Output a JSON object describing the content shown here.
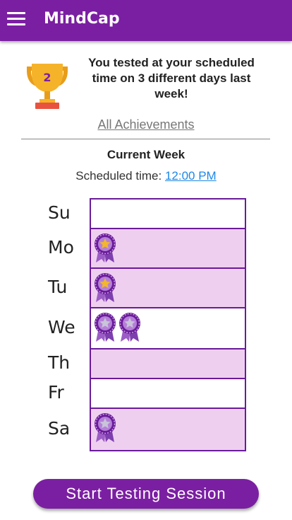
{
  "appbar": {
    "title": "MindCap"
  },
  "achievement": {
    "trophy_number": "2",
    "message": "You tested at your scheduled time on 3 different days last week!",
    "all_achievements_link": "All Achievements"
  },
  "week": {
    "title": "Current Week",
    "scheduled_label": "Scheduled time: ",
    "scheduled_time": "12:00 PM",
    "days": [
      {
        "label": "Su",
        "filled": false,
        "ribbons": []
      },
      {
        "label": "Mo",
        "filled": true,
        "ribbons": [
          "gold"
        ]
      },
      {
        "label": "Tu",
        "filled": true,
        "ribbons": [
          "gold"
        ]
      },
      {
        "label": "We",
        "filled": false,
        "ribbons": [
          "silver",
          "silver"
        ]
      },
      {
        "label": "Th",
        "filled": true,
        "ribbons": []
      },
      {
        "label": "Fr",
        "filled": false,
        "ribbons": []
      },
      {
        "label": "Sa",
        "filled": true,
        "ribbons": [
          "silver"
        ]
      }
    ]
  },
  "actions": {
    "start_label": "Start Testing Session"
  },
  "colors": {
    "primary": "#7b1fa2",
    "day_filled": "#efcff0",
    "link": "#1e88e5",
    "trophy_gold": "#f5b32a"
  }
}
